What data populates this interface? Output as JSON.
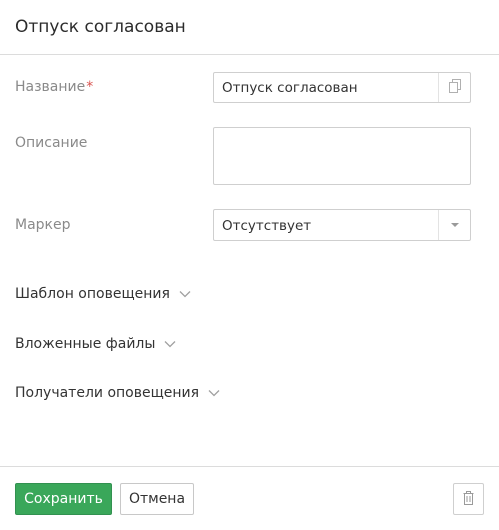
{
  "header": {
    "title": "Отпуск согласован"
  },
  "form": {
    "name": {
      "label": "Название",
      "required_mark": "*",
      "value": "Отпуск согласован",
      "copy_icon": "copy-icon"
    },
    "description": {
      "label": "Описание",
      "value": ""
    },
    "marker": {
      "label": "Маркер",
      "value": "Отсутствует",
      "arrow_icon": "caret-down-icon"
    }
  },
  "sections": [
    {
      "label": "Шаблон оповещения",
      "icon": "chevron-down-icon"
    },
    {
      "label": "Вложенные файлы",
      "icon": "chevron-down-icon"
    },
    {
      "label": "Получатели оповещения",
      "icon": "chevron-down-icon"
    }
  ],
  "footer": {
    "save_label": "Сохранить",
    "cancel_label": "Отмена",
    "delete_icon": "trash-icon"
  },
  "colors": {
    "primary": "#3aa75a",
    "required": "#d9534f",
    "label": "#8a8a8a",
    "border": "#cfcfcf"
  }
}
